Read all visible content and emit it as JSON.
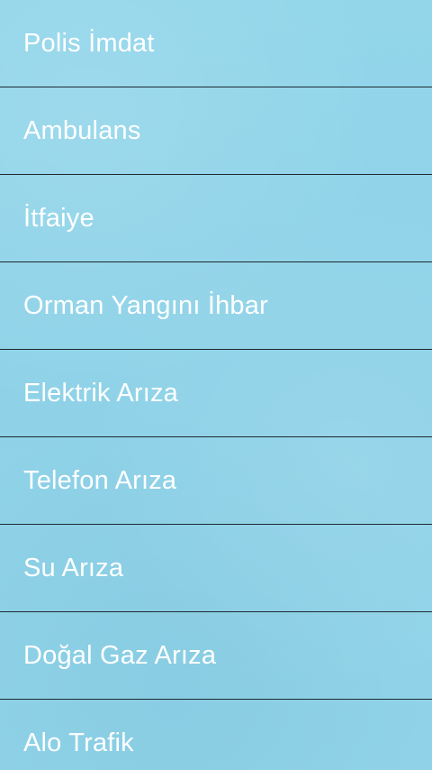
{
  "emergency_list": {
    "items": [
      {
        "label": "Polis İmdat"
      },
      {
        "label": "Ambulans"
      },
      {
        "label": "İtfaiye"
      },
      {
        "label": "Orman Yangını İhbar"
      },
      {
        "label": "Elektrik Arıza"
      },
      {
        "label": "Telefon Arıza"
      },
      {
        "label": "Su Arıza"
      },
      {
        "label": "Doğal Gaz Arıza"
      },
      {
        "label": "Alo Trafik"
      }
    ]
  }
}
